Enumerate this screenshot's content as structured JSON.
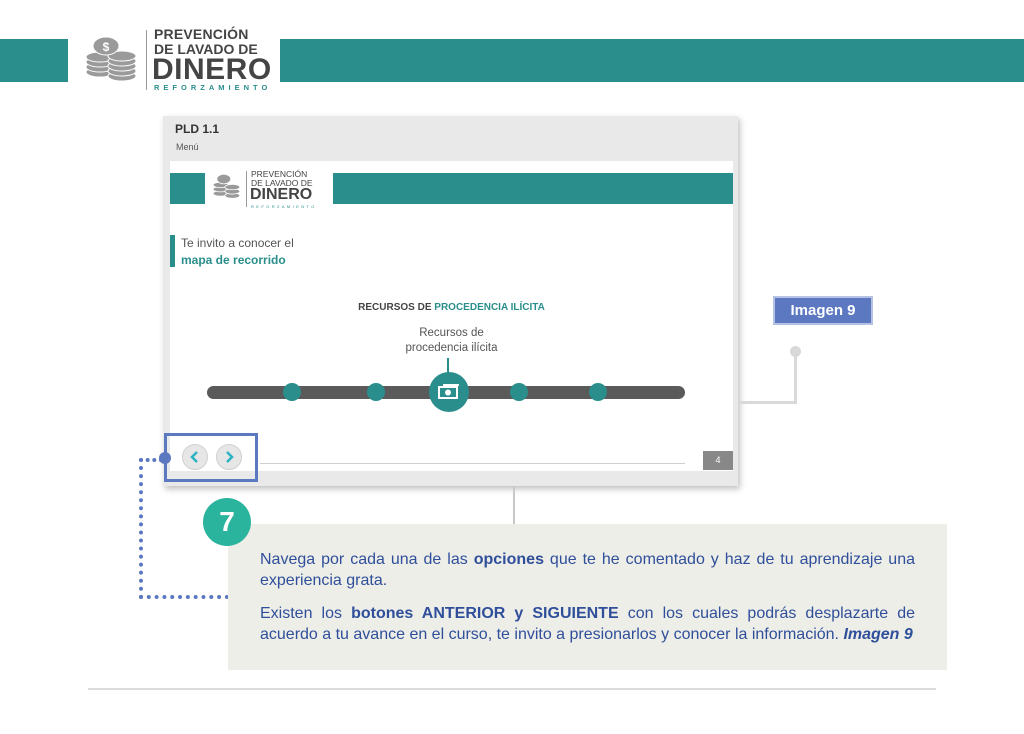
{
  "header": {
    "logo_line1": "PREVENCIÓN",
    "logo_line2": "DE LAVADO DE",
    "logo_line3": "DINERO",
    "logo_line4": "REFORZAMIENTO",
    "bar_color": "#2a8f8c"
  },
  "screenshot": {
    "title": "PLD 1.1",
    "menu": "Menú",
    "logo_line1": "PREVENCIÓN",
    "logo_line2": "DE LAVADO DE",
    "logo_line3": "DINERO",
    "logo_line4": "REFORZAMIENTO",
    "invite_line1": "Te invito a conocer el",
    "invite_line2": "mapa de recorrido",
    "resources_title_a": "RECURSOS DE",
    "resources_title_b": "PROCEDENCIA ILÍCITA",
    "resources_sub1": "Recursos de",
    "resources_sub2": "procedencia ilícita",
    "page_number": "4",
    "prev_icon": "chevron-left-icon",
    "next_icon": "chevron-right-icon"
  },
  "callout": {
    "label": "Imagen  9"
  },
  "step": {
    "number": "7",
    "p1_a": "Navega por cada una de las ",
    "p1_b": "opciones",
    "p1_c": " que te he comentado y haz de tu aprendizaje una experiencia grata.",
    "p2_a": "Existen los ",
    "p2_b": "botones ANTERIOR y SIGUIENTE",
    "p2_c": " con los cuales podrás desplazarte de acuerdo a tu avance en el curso, te invito a presionarlos y conocer la información. ",
    "p2_d": "Imagen 9"
  },
  "colors": {
    "teal": "#2a8f8c",
    "blue": "#5b78c0",
    "badge": "#2ab39d"
  }
}
